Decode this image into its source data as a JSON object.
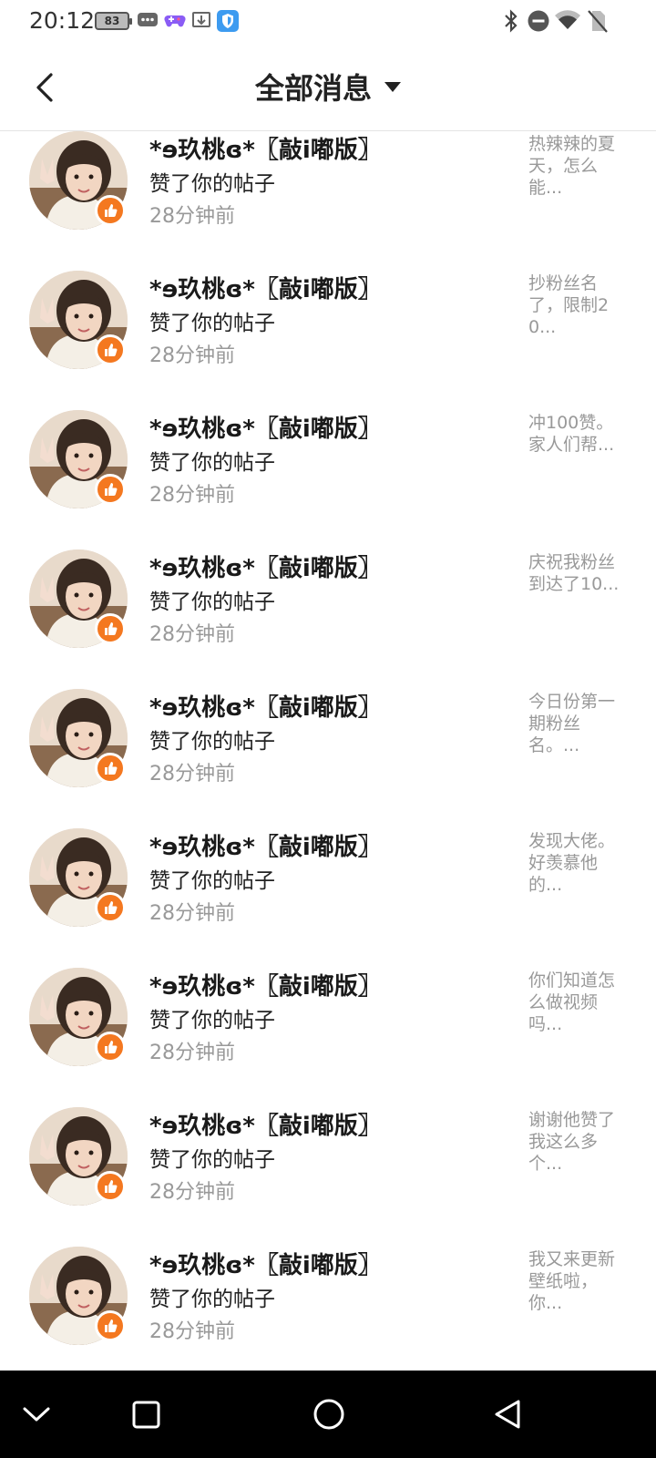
{
  "status_bar": {
    "time": "20:12",
    "battery": "83",
    "icons_left": [
      "chat-bubble-icon",
      "gamepad-icon",
      "cast-icon",
      "shield-app-icon"
    ],
    "icons_right": [
      "bluetooth-icon",
      "dnd-icon",
      "wifi-icon",
      "no-sim-icon"
    ]
  },
  "header": {
    "title": "全部消息"
  },
  "notifications": [
    {
      "name": "*ɘ玖桃ɞ*〖敲i嘟版〗",
      "action": "赞了你的帖子",
      "time": "28分钟前",
      "preview": "热辣辣的夏天，怎么能..."
    },
    {
      "name": "*ɘ玖桃ɞ*〖敲i嘟版〗",
      "action": "赞了你的帖子",
      "time": "28分钟前",
      "preview": "抄粉丝名了，限制20..."
    },
    {
      "name": "*ɘ玖桃ɞ*〖敲i嘟版〗",
      "action": "赞了你的帖子",
      "time": "28分钟前",
      "preview": "冲100赞。家人们帮..."
    },
    {
      "name": "*ɘ玖桃ɞ*〖敲i嘟版〗",
      "action": "赞了你的帖子",
      "time": "28分钟前",
      "preview": "庆祝我粉丝到达了10..."
    },
    {
      "name": "*ɘ玖桃ɞ*〖敲i嘟版〗",
      "action": "赞了你的帖子",
      "time": "28分钟前",
      "preview": "今日份第一期粉丝名。..."
    },
    {
      "name": "*ɘ玖桃ɞ*〖敲i嘟版〗",
      "action": "赞了你的帖子",
      "time": "28分钟前",
      "preview": "发现大佬。好羡慕他的..."
    },
    {
      "name": "*ɘ玖桃ɞ*〖敲i嘟版〗",
      "action": "赞了你的帖子",
      "time": "28分钟前",
      "preview": "你们知道怎么做视频吗..."
    },
    {
      "name": "*ɘ玖桃ɞ*〖敲i嘟版〗",
      "action": "赞了你的帖子",
      "time": "28分钟前",
      "preview": "谢谢他赞了我这么多个..."
    },
    {
      "name": "*ɘ玖桃ɞ*〖敲i嘟版〗",
      "action": "赞了你的帖子",
      "time": "28分钟前",
      "preview": "我又来更新壁纸啦，你..."
    }
  ],
  "colors": {
    "like_badge": "#f47820",
    "secondary_text": "#999999",
    "navbar": "#000000"
  },
  "navbar": {
    "buttons": [
      "collapse-icon",
      "recents-icon",
      "home-icon",
      "back-icon"
    ]
  }
}
